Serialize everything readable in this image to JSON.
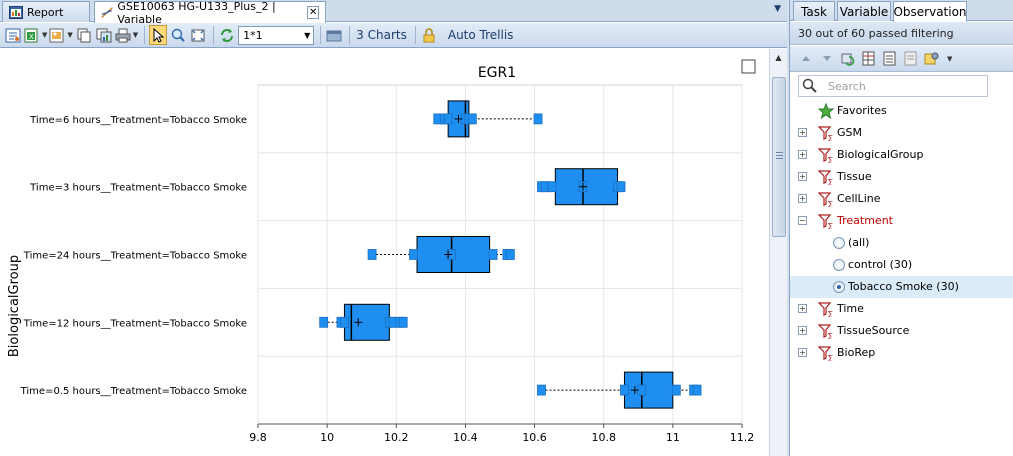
{
  "document_tabs": [
    {
      "label": "Report",
      "active": false
    },
    {
      "label": "GSE10063 HG-U133_Plus_2 | Variable",
      "active": true
    }
  ],
  "toolbar": {
    "zoom_value": "1*1",
    "charts_label": "3 Charts",
    "trellis_label": "Auto Trellis"
  },
  "right_panel": {
    "tabs": [
      "Task",
      "Variable",
      "Observation"
    ],
    "active_tab": "Observation",
    "filter_status": "30 out of 60 passed filtering",
    "search_placeholder": "Search",
    "tree": [
      {
        "label": "Favorites",
        "icon": "star-icon",
        "expander": "",
        "type": "favorites"
      },
      {
        "label": "GSM",
        "icon": "filter-icon",
        "expander": "+",
        "type": "variable"
      },
      {
        "label": "BiologicalGroup",
        "icon": "filter-icon",
        "expander": "+",
        "type": "variable"
      },
      {
        "label": "Tissue",
        "icon": "filter-icon",
        "expander": "+",
        "type": "variable"
      },
      {
        "label": "CellLine",
        "icon": "filter-icon",
        "expander": "+",
        "type": "variable"
      },
      {
        "label": "Treatment",
        "icon": "filter-icon",
        "expander": "−",
        "type": "variable",
        "active": true
      },
      {
        "label": "(all)",
        "type": "option",
        "checked": false
      },
      {
        "label": "control (30)",
        "type": "option",
        "checked": false
      },
      {
        "label": "Tobacco Smoke (30)",
        "type": "option",
        "checked": true,
        "selected": true
      },
      {
        "label": "Time",
        "icon": "filter-icon",
        "expander": "+",
        "type": "variable"
      },
      {
        "label": "TissueSource",
        "icon": "filter-icon",
        "expander": "+",
        "type": "variable"
      },
      {
        "label": "BioRep",
        "icon": "filter-icon",
        "expander": "+",
        "type": "variable"
      }
    ]
  },
  "colors": {
    "box_fill": "#1e8ff0",
    "box_stroke": "#000000",
    "grid": "#e6e6e6",
    "accent_red": "#c00000"
  },
  "chart_data": {
    "type": "boxplot",
    "orientation": "horizontal",
    "title": "EGR1",
    "ylabel": "BiologicalGroup",
    "xlabel": "",
    "xlim": [
      9.8,
      11.2
    ],
    "xticks": [
      "9.8",
      "10",
      "10.2",
      "10.4",
      "10.6",
      "10.8",
      "11",
      "11.2"
    ],
    "grid": true,
    "categories": [
      "Time=6 hours__Treatment=Tobacco Smoke",
      "Time=3 hours__Treatment=Tobacco Smoke",
      "Time=24 hours__Treatment=Tobacco Smoke",
      "Time=12 hours__Treatment=Tobacco Smoke",
      "Time=0.5 hours__Treatment=Tobacco Smoke"
    ],
    "boxes": [
      {
        "whisker_low": 10.32,
        "q1": 10.35,
        "median": 10.4,
        "q3": 10.41,
        "whisker_high": 10.61,
        "mean": 10.38,
        "points": [
          10.32,
          10.34,
          10.35,
          10.4,
          10.41,
          10.42,
          10.61
        ]
      },
      {
        "whisker_low": 10.62,
        "q1": 10.66,
        "median": 10.74,
        "q3": 10.84,
        "whisker_high": 10.85,
        "mean": 10.74,
        "points": [
          10.62,
          10.63,
          10.65,
          10.74,
          10.84,
          10.85
        ]
      },
      {
        "whisker_low": 10.13,
        "q1": 10.26,
        "median": 10.36,
        "q3": 10.47,
        "whisker_high": 10.53,
        "mean": 10.35,
        "points": [
          10.13,
          10.25,
          10.36,
          10.48,
          10.52,
          10.53
        ]
      },
      {
        "whisker_low": 9.99,
        "q1": 10.05,
        "median": 10.07,
        "q3": 10.18,
        "whisker_high": 10.22,
        "mean": 10.09,
        "points": [
          9.99,
          10.04,
          10.05,
          10.18,
          10.19,
          10.21,
          10.22
        ]
      },
      {
        "whisker_low": 10.62,
        "q1": 10.86,
        "median": 10.91,
        "q3": 11.0,
        "whisker_high": 11.07,
        "mean": 10.89,
        "points": [
          10.62,
          10.86,
          10.91,
          11.01,
          11.06,
          11.07
        ]
      }
    ]
  }
}
